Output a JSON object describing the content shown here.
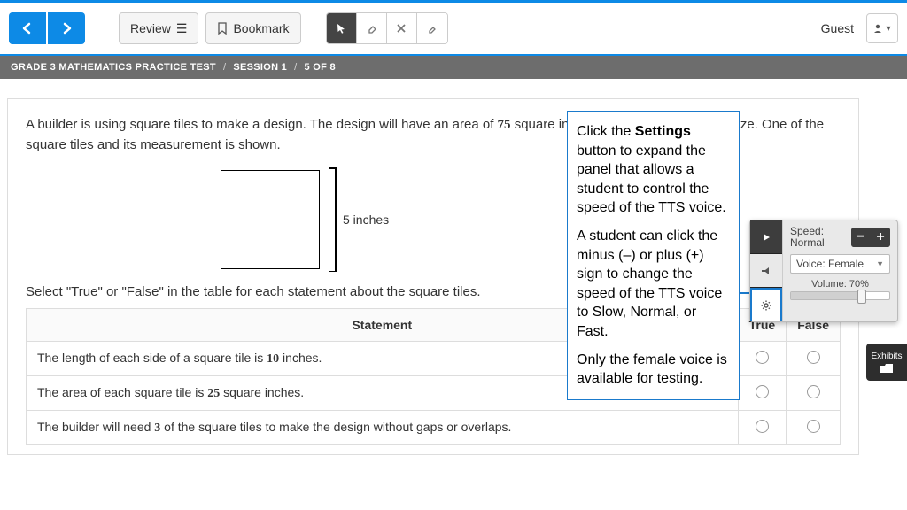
{
  "toolbar": {
    "review_label": "Review",
    "bookmark_label": "Bookmark",
    "guest_label": "Guest"
  },
  "breadcrumb": {
    "test": "GRADE 3 MATHEMATICS PRACTICE TEST",
    "session": "SESSION 1",
    "progress": "5 OF 8"
  },
  "question": {
    "intro_a": "A builder is using square tiles to make a design. The design will have an area of ",
    "area": "75",
    "intro_b": " square inches. Each tile is the same size. One of the square tiles and its measurement is shown.",
    "tile_label": "5 inches",
    "instruction": "Select \"True\" or \"False\" in the table for each statement about the square tiles.",
    "headers": {
      "stmt": "Statement",
      "true": "True",
      "false": "False"
    },
    "rows": [
      {
        "pre": "The length of each side of a square tile is ",
        "num": "10",
        "post": " inches."
      },
      {
        "pre": "The area of each square tile is ",
        "num": "25",
        "post": " square inches."
      },
      {
        "pre": "The builder will need ",
        "num": "3",
        "post": " of the square tiles to make the design without gaps or overlaps."
      }
    ]
  },
  "callout": {
    "p1a": "Click the ",
    "p1b": "Settings",
    "p1c": " button to expand the panel that allows a student to control the speed of the TTS voice.",
    "p2": "A student can click the minus (–) or plus (+) sign to change the speed of the TTS voice to Slow, Normal, or Fast.",
    "p3": "Only the female voice is available for testing."
  },
  "tts": {
    "speed_label": "Speed:",
    "speed_value": "Normal",
    "voice_label": "Voice: Female",
    "volume_label": "Volume: 70%",
    "volume_pct": 70
  },
  "exhibits": {
    "label": "Exhibits"
  }
}
